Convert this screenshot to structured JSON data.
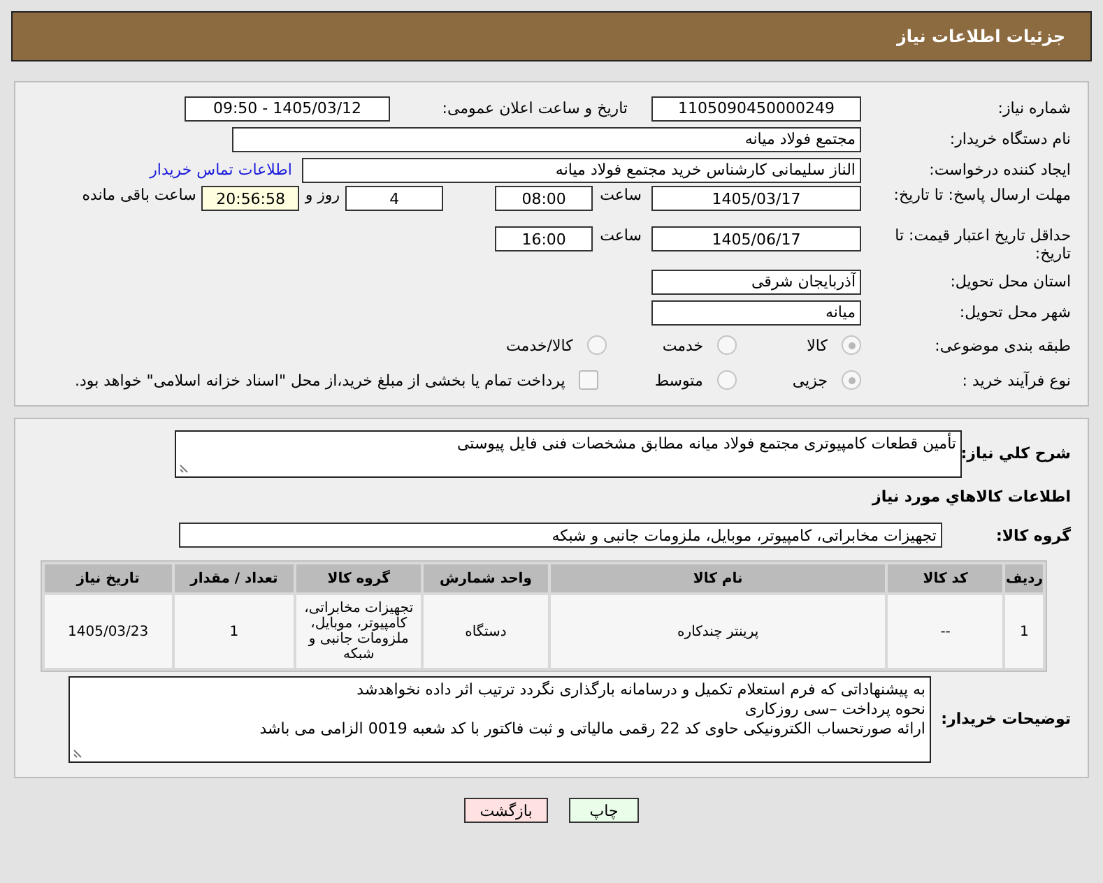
{
  "header": {
    "title": "جزئیات اطلاعات نیاز"
  },
  "info": {
    "need_number": {
      "label": "شماره نیاز:",
      "value": "1105090450000249"
    },
    "announce": {
      "label": "تاریخ و ساعت اعلان عمومی:",
      "value": "1405/03/12 - 09:50"
    },
    "buyer_org": {
      "label": "نام دستگاه خریدار:",
      "value": "مجتمع فولاد میانه"
    },
    "requester": {
      "label": "ایجاد کننده درخواست:",
      "value": "الناز سلیمانی کارشناس خرید مجتمع فولاد میانه",
      "link": "اطلاعات تماس خریدار"
    },
    "deadline": {
      "label": "مهلت ارسال پاسخ: تا تاریخ:",
      "date": "1405/03/17",
      "time_label": "ساعت",
      "time": "08:00",
      "days": "4",
      "days_label": "روز و",
      "remaining": "20:56:58",
      "remaining_label": "ساعت باقی مانده"
    },
    "validity": {
      "label": "حداقل تاریخ اعتبار قیمت: تا تاریخ:",
      "date": "1405/06/17",
      "time_label": "ساعت",
      "time": "16:00"
    },
    "province": {
      "label": "استان محل تحویل:",
      "value": "آذربایجان شرقی"
    },
    "city": {
      "label": "شهر محل تحویل:",
      "value": "میانه"
    },
    "category": {
      "label": "طبقه بندی موضوعی:",
      "options": [
        {
          "label": "کالا",
          "selected": true
        },
        {
          "label": "خدمت",
          "selected": false
        },
        {
          "label": "کالا/خدمت",
          "selected": false
        }
      ]
    },
    "process": {
      "label": "نوع فرآیند خرید :",
      "options": [
        {
          "label": "جزیی",
          "selected": true
        },
        {
          "label": "متوسط",
          "selected": false
        }
      ],
      "payment": {
        "label": "پرداخت تمام یا بخشی از مبلغ خرید،از محل \"اسناد خزانه اسلامی\" خواهد بود.",
        "checked": false
      }
    }
  },
  "details": {
    "description": {
      "label": "شرح کلي نیاز:",
      "value": "تأمین قطعات کامپیوتری مجتمع فولاد میانه مطابق مشخصات فنی فایل پیوستی"
    },
    "goods_heading": "اطلاعات کالاهاي مورد نیاز",
    "goods_group": {
      "label": "گروه کالا:",
      "value": "تجهیزات مخابراتی، کامپیوتر، موبایل، ملزومات جانبی و شبکه"
    },
    "table": {
      "columns": [
        "ردیف",
        "کد کالا",
        "نام کالا",
        "واحد شمارش",
        "گروه کالا",
        "تعداد / مقدار",
        "تاریخ نیاز"
      ],
      "rows": [
        [
          "1",
          "--",
          "پرینتر چندکاره",
          "دستگاه",
          "تجهیزات مخابراتی، کامپیوتر، موبایل، ملزومات جانبی و شبکه",
          "1",
          "1405/03/23"
        ]
      ]
    },
    "buyer_notes": {
      "label": "توضیحات خریدار:",
      "lines": [
        "به پیشنهاداتی که فرم استعلام تکمیل و درسامانه بارگذاری نگردد ترتیب اثر داده نخواهدشد",
        "نحوه پرداخت –سی روزکاری",
        "ارائه صورتحساب الکترونیکی حاوی کد 22 رقمی مالیاتی و ثبت فاکتور با کد شعبه 0019 الزامی می باشد"
      ]
    }
  },
  "buttons": [
    {
      "kind": "print",
      "label": "چاپ"
    },
    {
      "kind": "back",
      "label": "بازگشت"
    }
  ]
}
